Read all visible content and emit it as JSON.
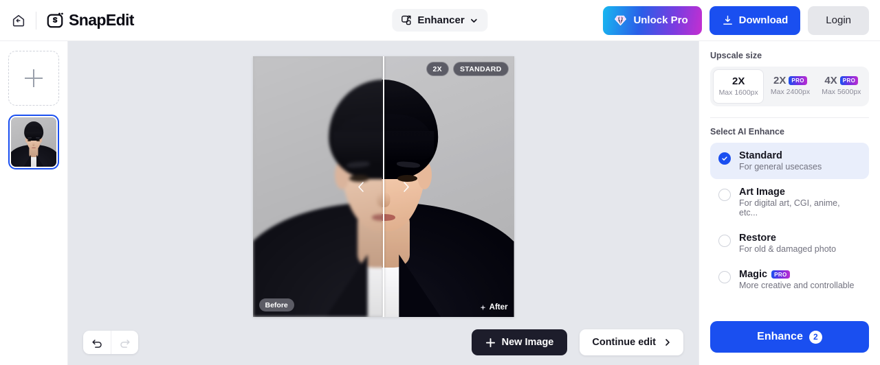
{
  "header": {
    "home_icon": "home-back-icon",
    "brand": "SnapEdit",
    "tool_selector": {
      "label": "Enhancer",
      "icon": "enhance-frame-icon",
      "chevron": "chevron-down-icon"
    },
    "unlock_pro": {
      "label": "Unlock Pro",
      "icon": "diamond-icon"
    },
    "download": {
      "label": "Download",
      "icon": "download-icon"
    },
    "login": {
      "label": "Login"
    }
  },
  "sidebar": {
    "add_label": "+",
    "add_icon": "plus-icon",
    "thumbnails": [
      {
        "name": "portrait-thumbnail",
        "selected": true
      }
    ]
  },
  "canvas": {
    "badges": {
      "zoom": "2X",
      "mode": "STANDARD"
    },
    "before_label": "Before",
    "after_label": "After",
    "after_icon": "sparkle-icon",
    "slider": {
      "left_icon": "chevron-left-icon",
      "right_icon": "chevron-right-icon",
      "position_percent": 50
    },
    "undo": {
      "icon": "undo-icon",
      "enabled": true
    },
    "redo": {
      "icon": "redo-icon",
      "enabled": false
    },
    "new_image": {
      "label": "New Image",
      "icon": "plus-icon"
    },
    "continue_edit": {
      "label": "Continue edit",
      "icon": "chevron-right-icon"
    }
  },
  "panel": {
    "upscale_title": "Upscale size",
    "upscale_options": [
      {
        "factor": "2X",
        "max": "Max 1600px",
        "pro": false,
        "active": true
      },
      {
        "factor": "2X",
        "max": "Max 2400px",
        "pro": true,
        "active": false
      },
      {
        "factor": "4X",
        "max": "Max 5600px",
        "pro": true,
        "active": false
      }
    ],
    "pro_badge": "PRO",
    "enhance_title": "Select AI Enhance",
    "enhance_options": [
      {
        "title": "Standard",
        "desc": "For general usecases",
        "pro": false,
        "selected": true
      },
      {
        "title": "Art Image",
        "desc": "For digital art, CGI, anime, etc...",
        "pro": false,
        "selected": false
      },
      {
        "title": "Restore",
        "desc": "For old & damaged photo",
        "pro": false,
        "selected": false
      },
      {
        "title": "Magic",
        "desc": "More creative and controllable",
        "pro": true,
        "selected": false
      }
    ],
    "enhance_button": {
      "label": "Enhance",
      "count": "2"
    }
  },
  "colors": {
    "accent_blue": "#1a4ff0",
    "canvas_bg": "#e5e7ec",
    "dark_button": "#1d1d2b",
    "selected_option_bg": "#e9eefb"
  }
}
